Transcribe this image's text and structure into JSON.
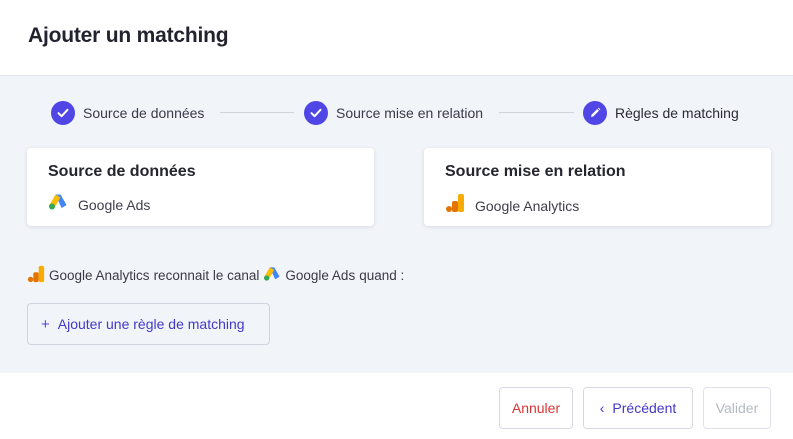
{
  "header": {
    "title": "Ajouter un matching"
  },
  "stepper": {
    "steps": [
      {
        "label": "Source de données",
        "state": "done",
        "icon": "check-icon"
      },
      {
        "label": "Source mise en relation",
        "state": "done",
        "icon": "check-icon"
      },
      {
        "label": "Règles de matching",
        "state": "active",
        "icon": "pencil-icon"
      }
    ]
  },
  "cards": {
    "data_source": {
      "title": "Source de données",
      "source_name": "Google Ads",
      "icon": "google-ads-icon"
    },
    "related_source": {
      "title": "Source mise en relation",
      "source_name": "Google Analytics",
      "icon": "google-analytics-icon"
    }
  },
  "statement": {
    "source": "Google Analytics",
    "middle": "reconnait le canal",
    "channel": "Google Ads",
    "end": "quand :"
  },
  "add_rule": {
    "plus": "+",
    "label": "Ajouter une règle de matching"
  },
  "footer": {
    "cancel": "Annuler",
    "previous": "Précédent",
    "previous_chevron": "‹",
    "validate": "Valider"
  },
  "colors": {
    "accent": "#4f46e5",
    "danger": "#d93535",
    "body_bg": "#f1f4f9",
    "disabled": "#b4b8c2"
  }
}
